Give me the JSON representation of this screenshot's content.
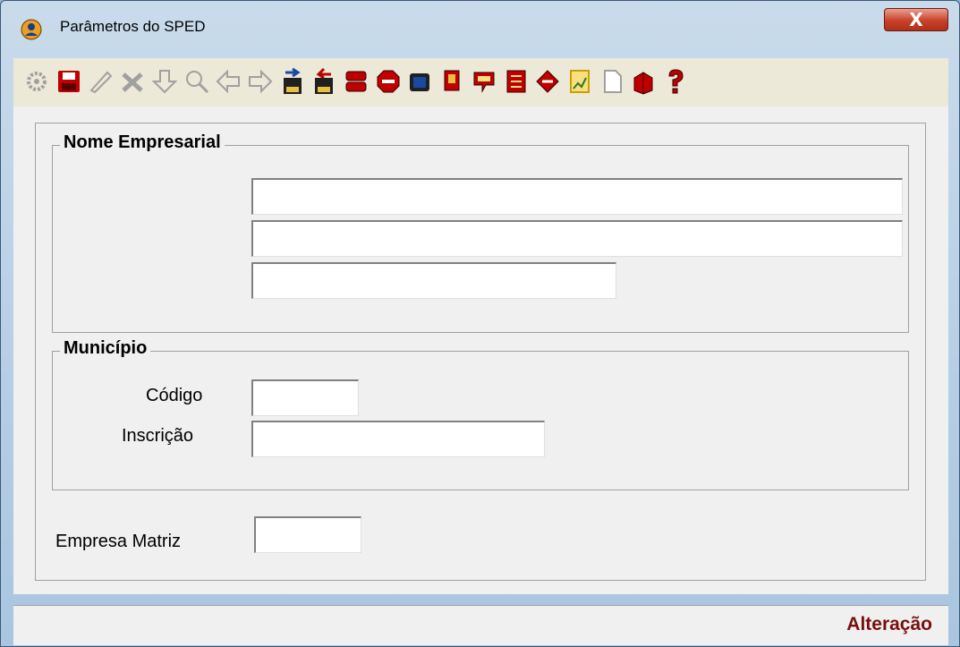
{
  "window": {
    "title": "Parâmetros do SPED",
    "close_label": "X"
  },
  "toolbar": {
    "buttons": [
      {
        "name": "gear-icon",
        "color": "#a0a0a0"
      },
      {
        "name": "save-icon",
        "color": "#c00000"
      },
      {
        "name": "edit-icon",
        "color": "#a0a0a0"
      },
      {
        "name": "cancel-icon",
        "color": "#a0a0a0"
      },
      {
        "name": "down-arrow-icon",
        "color": "#a0a0a0"
      },
      {
        "name": "search-icon",
        "color": "#a0a0a0"
      },
      {
        "name": "prev-arrow-icon",
        "color": "#a0a0a0"
      },
      {
        "name": "next-arrow-icon",
        "color": "#a0a0a0"
      },
      {
        "name": "export-xy-icon",
        "color": "#1a4aa0"
      },
      {
        "name": "import-xy-icon",
        "color": "#c00000"
      },
      {
        "name": "list-icon",
        "color": "#c00000"
      },
      {
        "name": "stop-icon",
        "color": "#c00000"
      },
      {
        "name": "calculator-icon",
        "color": "#1a4aa0"
      },
      {
        "name": "document-icon",
        "color": "#c00000"
      },
      {
        "name": "comment-icon",
        "color": "#c00000"
      },
      {
        "name": "report-icon",
        "color": "#c00000"
      },
      {
        "name": "transfer-icon",
        "color": "#c00000"
      },
      {
        "name": "chart-icon",
        "color": "#c8a000"
      },
      {
        "name": "page-icon",
        "color": "#a0a0a0"
      },
      {
        "name": "open-box-icon",
        "color": "#c00000"
      },
      {
        "name": "help-icon",
        "color": "#c00000"
      }
    ]
  },
  "nome_empresarial": {
    "title": "Nome Empresarial",
    "line1": "",
    "line2": "",
    "line3": ""
  },
  "municipio": {
    "title": "Município",
    "codigo_label": "Código",
    "codigo_value": "",
    "inscricao_label": "Inscrição",
    "inscricao_value": ""
  },
  "empresa_matriz": {
    "label": "Empresa Matriz",
    "value": ""
  },
  "status": {
    "mode": "Alteração"
  }
}
